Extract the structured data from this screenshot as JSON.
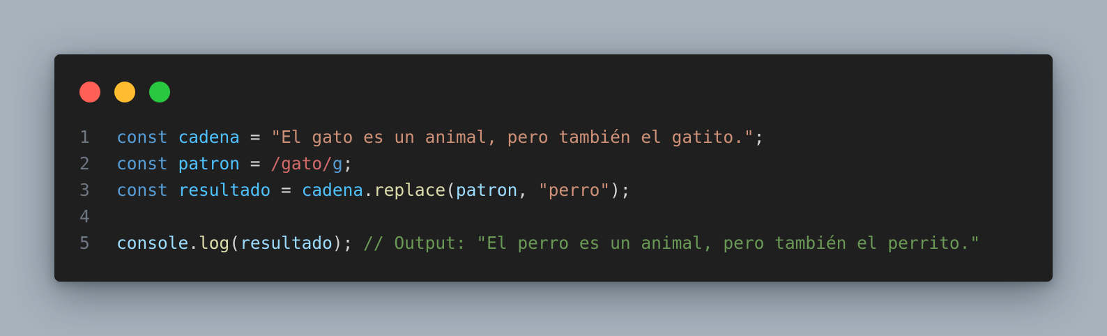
{
  "window": {
    "controls": [
      {
        "name": "close",
        "color": "#ff5f57"
      },
      {
        "name": "minimize",
        "color": "#febc2e"
      },
      {
        "name": "maximize",
        "color": "#28c840"
      }
    ]
  },
  "code": {
    "language": "javascript",
    "lines": [
      {
        "number": "1",
        "tokens": [
          {
            "text": "const",
            "type": "keyword"
          },
          {
            "text": " ",
            "type": "space"
          },
          {
            "text": "cadena",
            "type": "variable"
          },
          {
            "text": " = ",
            "type": "operator"
          },
          {
            "text": "\"El gato es un animal, pero también el gatito.\"",
            "type": "string"
          },
          {
            "text": ";",
            "type": "punctuation"
          }
        ]
      },
      {
        "number": "2",
        "tokens": [
          {
            "text": "const",
            "type": "keyword"
          },
          {
            "text": " ",
            "type": "space"
          },
          {
            "text": "patron",
            "type": "variable"
          },
          {
            "text": " = ",
            "type": "operator"
          },
          {
            "text": "/gato/",
            "type": "regex"
          },
          {
            "text": "g",
            "type": "regex-flag"
          },
          {
            "text": ";",
            "type": "punctuation"
          }
        ]
      },
      {
        "number": "3",
        "tokens": [
          {
            "text": "const",
            "type": "keyword"
          },
          {
            "text": " ",
            "type": "space"
          },
          {
            "text": "resultado",
            "type": "variable"
          },
          {
            "text": " = ",
            "type": "operator"
          },
          {
            "text": "cadena",
            "type": "variable"
          },
          {
            "text": ".",
            "type": "punctuation"
          },
          {
            "text": "replace",
            "type": "function"
          },
          {
            "text": "(",
            "type": "punctuation"
          },
          {
            "text": "patron",
            "type": "property"
          },
          {
            "text": ", ",
            "type": "punctuation"
          },
          {
            "text": "\"perro\"",
            "type": "string"
          },
          {
            "text": ");",
            "type": "punctuation"
          }
        ]
      },
      {
        "number": "4",
        "tokens": []
      },
      {
        "number": "5",
        "tokens": [
          {
            "text": "console",
            "type": "property"
          },
          {
            "text": ".",
            "type": "punctuation"
          },
          {
            "text": "log",
            "type": "function"
          },
          {
            "text": "(",
            "type": "punctuation"
          },
          {
            "text": "resultado",
            "type": "property"
          },
          {
            "text": "); ",
            "type": "punctuation"
          },
          {
            "text": "// Output: \"El perro es un animal, pero también el perrito.\"",
            "type": "comment"
          }
        ]
      }
    ]
  }
}
